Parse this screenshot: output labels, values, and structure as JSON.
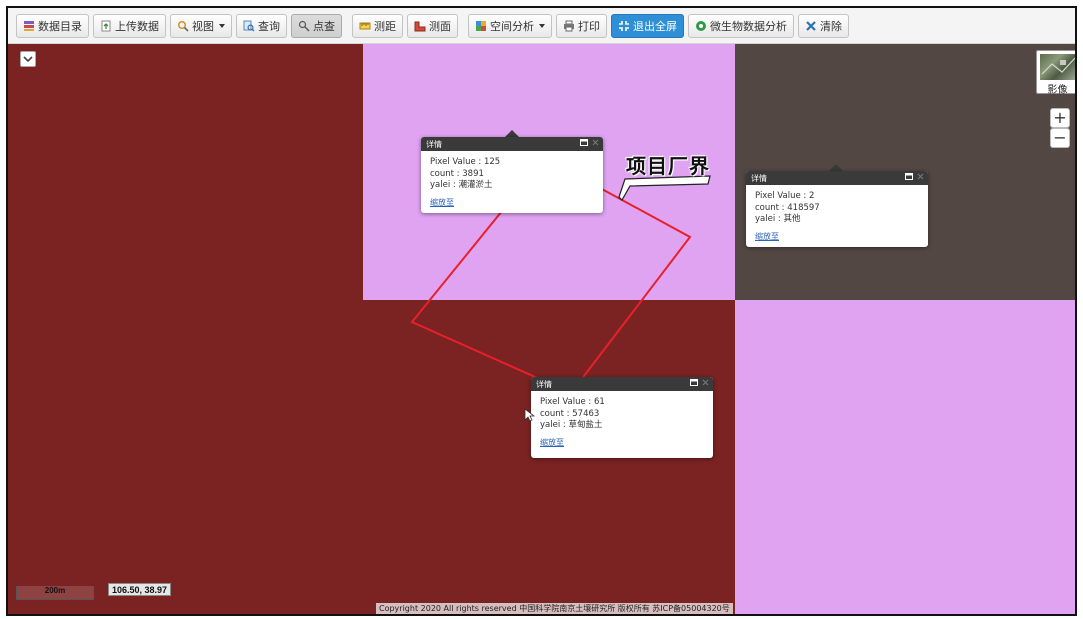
{
  "toolbar": {
    "items": [
      {
        "label": "数据目录",
        "icon": "database-icon",
        "dropdown": false,
        "state": "normal"
      },
      {
        "label": "上传数据",
        "icon": "upload-icon",
        "dropdown": false,
        "state": "normal"
      },
      {
        "label": "视图",
        "icon": "view-icon",
        "dropdown": true,
        "state": "normal"
      },
      {
        "label": "查询",
        "icon": "query-icon",
        "dropdown": false,
        "state": "normal"
      },
      {
        "label": "点查",
        "icon": "point-query-icon",
        "dropdown": false,
        "state": "active"
      },
      {
        "label": "测距",
        "icon": "measure-distance-icon",
        "dropdown": false,
        "state": "normal"
      },
      {
        "label": "测面",
        "icon": "measure-area-icon",
        "dropdown": false,
        "state": "normal"
      },
      {
        "label": "空间分析",
        "icon": "spatial-analysis-icon",
        "dropdown": true,
        "state": "normal"
      },
      {
        "label": "打印",
        "icon": "print-icon",
        "dropdown": false,
        "state": "normal"
      },
      {
        "label": "退出全屏",
        "icon": "exit-fullscreen-icon",
        "dropdown": false,
        "state": "primary"
      },
      {
        "label": "微生物数据分析",
        "icon": "microbe-analysis-icon",
        "dropdown": false,
        "state": "normal"
      },
      {
        "label": "清除",
        "icon": "clear-icon",
        "dropdown": false,
        "state": "normal"
      }
    ]
  },
  "map": {
    "colors": {
      "dark_red": "#7b2222",
      "pink": "#dfa3f2",
      "dark_gray": "#534744",
      "boundary": "#e8202a"
    },
    "annotation_label": "项目厂界",
    "basemap_label": "影像",
    "zoom_in": "+",
    "zoom_out": "−",
    "scale_label": "200m",
    "coordinates": "106.50, 38.97",
    "copyright": "Copyright 2020 All rights reserved 中国科学院南京土壤研究所 版权所有 苏ICP备05004320号",
    "collapse_icon": "chevron-down-icon"
  },
  "popups": [
    {
      "title": "详情",
      "pixel_value": "Pixel Value : 125",
      "count": "count : 3891",
      "yalei": "yalei : 潮灌淤土",
      "zoom_link": "缩放至"
    },
    {
      "title": "详情",
      "pixel_value": "Pixel Value : 2",
      "count": "count : 418597",
      "yalei": "yalei : 其他",
      "zoom_link": "缩放至"
    },
    {
      "title": "详情",
      "pixel_value": "Pixel Value : 61",
      "count": "count : 57463",
      "yalei": "yalei : 草甸盐土",
      "zoom_link": "缩放至"
    }
  ]
}
